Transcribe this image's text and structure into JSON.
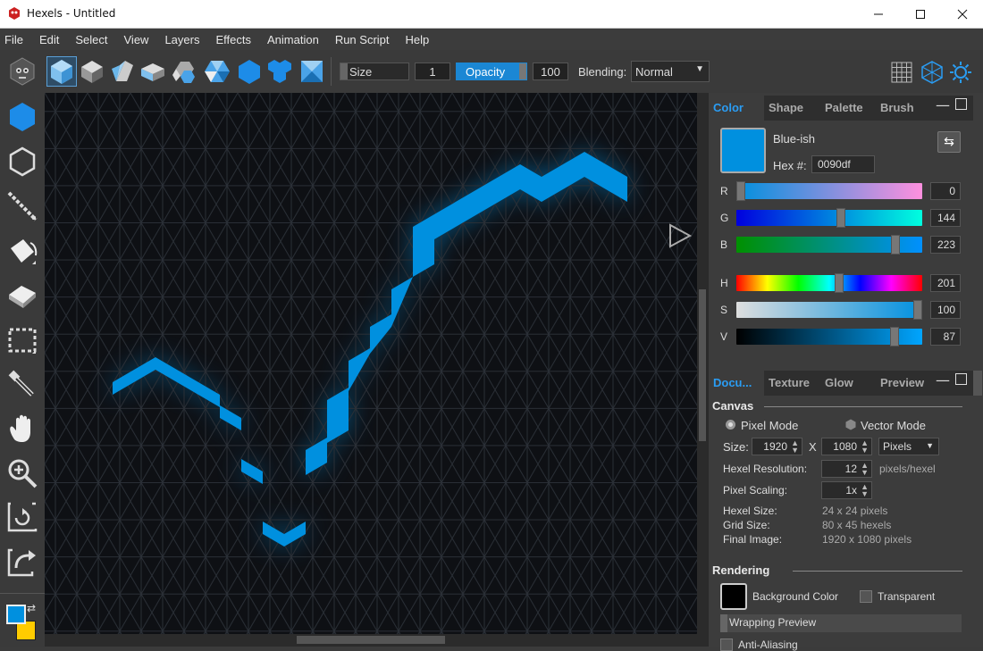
{
  "window": {
    "title": "Hexels - Untitled",
    "minimize_label": "—",
    "maximize_label": "☐",
    "close_label": "✕"
  },
  "menu": [
    "File",
    "Edit",
    "Select",
    "View",
    "Layers",
    "Effects",
    "Animation",
    "Run Script",
    "Help"
  ],
  "toolbar": {
    "size_label": "Size",
    "size_value": "1",
    "opacity_label": "Opacity",
    "opacity_value": "100",
    "blending_label": "Blending:",
    "blending_value": "Normal"
  },
  "left_tools": [
    "hexagon-fill-tool",
    "hexagon-outline-tool",
    "line-tool",
    "paint-bucket-tool",
    "eraser-tool",
    "marquee-select-tool",
    "eyedropper-tool",
    "hand-tool",
    "zoom-tool",
    "rotate-canvas-tool",
    "export-tool"
  ],
  "colors": {
    "accent": "#2a9df4",
    "primary": "#0090df",
    "secondary": "#ffcc00",
    "background": "#000000"
  },
  "color_panel": {
    "tabs": [
      "Color",
      "Shape",
      "Palette",
      "Brush"
    ],
    "swatch_name": "Blue-ish",
    "hex_label": "Hex #:",
    "hex_value": "0090df",
    "channels": [
      {
        "label": "R",
        "value": "0",
        "fraction": 0.0
      },
      {
        "label": "G",
        "value": "144",
        "fraction": 0.565
      },
      {
        "label": "B",
        "value": "223",
        "fraction": 0.875
      },
      {
        "label": "H",
        "value": "201",
        "fraction": 0.558
      },
      {
        "label": "S",
        "value": "100",
        "fraction": 1.0
      },
      {
        "label": "V",
        "value": "87",
        "fraction": 0.87
      }
    ]
  },
  "doc_panel": {
    "tabs": [
      "Docu...",
      "Texture",
      "Glow",
      "Preview"
    ],
    "canvas_title": "Canvas",
    "pixel_mode": "Pixel Mode",
    "vector_mode": "Vector Mode",
    "size_label": "Size:",
    "width": "1920",
    "x_sep": "X",
    "height": "1080",
    "unit": "Pixels",
    "hexel_resolution_label": "Hexel Resolution:",
    "hexel_resolution": "12",
    "hexel_resolution_unit": "pixels/hexel",
    "pixel_scaling_label": "Pixel Scaling:",
    "pixel_scaling": "1x",
    "hexel_size_label": "Hexel Size:",
    "hexel_size": "24 x 24 pixels",
    "grid_size_label": "Grid Size:",
    "grid_size": "80 x 45 hexels",
    "final_image_label": "Final Image:",
    "final_image": "1920 x 1080 pixels",
    "rendering_title": "Rendering",
    "background_color_label": "Background Color",
    "transparent_label": "Transparent",
    "wrapping_preview_label": "Wrapping Preview",
    "anti_aliasing_label": "Anti-Aliasing"
  }
}
